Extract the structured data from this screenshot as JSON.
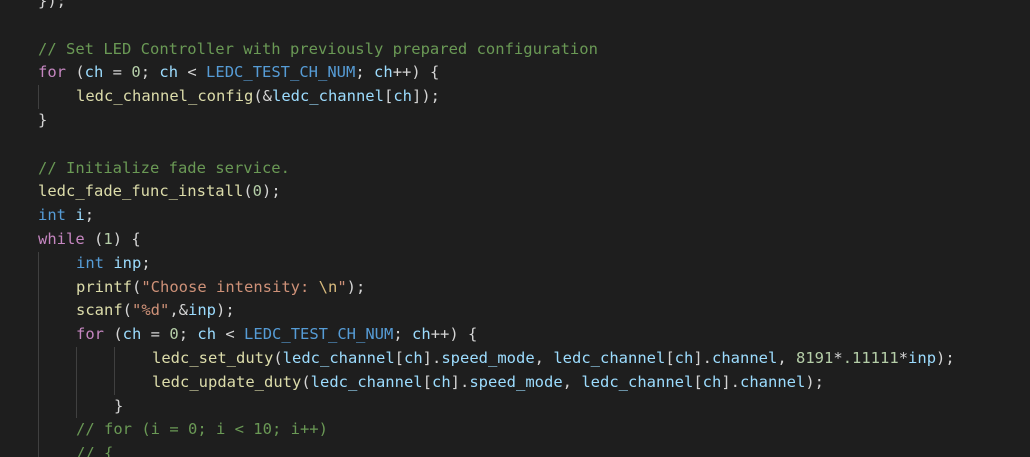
{
  "editor": {
    "background": "#1e1e1e",
    "theme_colors": {
      "keyword": "#569cd6",
      "control": "#c586c0",
      "function": "#dcdcaa",
      "variable": "#9cdcfe",
      "number": "#b5cea8",
      "string": "#ce9178",
      "comment": "#6a9955",
      "text": "#d4d4d4"
    },
    "lines": [
      {
        "indent": 0,
        "tokens": [
          [
            "pun",
            "});"
          ]
        ]
      },
      {
        "indent": 0,
        "tokens": []
      },
      {
        "indent": 0,
        "tokens": [
          [
            "cmt",
            "// Set LED Controller with previously prepared configuration"
          ]
        ]
      },
      {
        "indent": 0,
        "tokens": [
          [
            "ctl",
            "for"
          ],
          [
            "pun",
            " ("
          ],
          [
            "var",
            "ch"
          ],
          [
            "pun",
            " = "
          ],
          [
            "num",
            "0"
          ],
          [
            "pun",
            "; "
          ],
          [
            "var",
            "ch"
          ],
          [
            "pun",
            " < "
          ],
          [
            "mac",
            "LEDC_TEST_CH_NUM"
          ],
          [
            "pun",
            "; "
          ],
          [
            "var",
            "ch"
          ],
          [
            "pun",
            "++) {"
          ]
        ]
      },
      {
        "indent": 1,
        "tokens": [
          [
            "fn",
            "ledc_channel_config"
          ],
          [
            "pun",
            "(&"
          ],
          [
            "var",
            "ledc_channel"
          ],
          [
            "pun",
            "["
          ],
          [
            "var",
            "ch"
          ],
          [
            "pun",
            "]);"
          ]
        ]
      },
      {
        "indent": 0,
        "tokens": [
          [
            "pun",
            "}"
          ]
        ]
      },
      {
        "indent": 0,
        "tokens": []
      },
      {
        "indent": 0,
        "tokens": [
          [
            "cmt",
            "// Initialize fade service."
          ]
        ]
      },
      {
        "indent": 0,
        "tokens": [
          [
            "fn",
            "ledc_fade_func_install"
          ],
          [
            "pun",
            "("
          ],
          [
            "num",
            "0"
          ],
          [
            "pun",
            ");"
          ]
        ]
      },
      {
        "indent": 0,
        "tokens": [
          [
            "kw",
            "int"
          ],
          [
            "pun",
            " "
          ],
          [
            "var",
            "i"
          ],
          [
            "pun",
            ";"
          ]
        ]
      },
      {
        "indent": 0,
        "tokens": [
          [
            "ctl",
            "while"
          ],
          [
            "pun",
            " ("
          ],
          [
            "num",
            "1"
          ],
          [
            "pun",
            ") {"
          ]
        ]
      },
      {
        "indent": 1,
        "tokens": [
          [
            "kw",
            "int"
          ],
          [
            "pun",
            " "
          ],
          [
            "var",
            "inp"
          ],
          [
            "pun",
            ";"
          ]
        ]
      },
      {
        "indent": 1,
        "tokens": [
          [
            "fn",
            "printf"
          ],
          [
            "pun",
            "("
          ],
          [
            "str",
            "\"Choose intensity: "
          ],
          [
            "esc",
            "\\n"
          ],
          [
            "str",
            "\""
          ],
          [
            "pun",
            ");"
          ]
        ]
      },
      {
        "indent": 1,
        "tokens": [
          [
            "fn",
            "scanf"
          ],
          [
            "pun",
            "("
          ],
          [
            "str",
            "\"%d\""
          ],
          [
            "pun",
            ",&"
          ],
          [
            "var",
            "inp"
          ],
          [
            "pun",
            ");"
          ]
        ]
      },
      {
        "indent": 1,
        "tokens": [
          [
            "ctl",
            "for"
          ],
          [
            "pun",
            " ("
          ],
          [
            "var",
            "ch"
          ],
          [
            "pun",
            " = "
          ],
          [
            "num",
            "0"
          ],
          [
            "pun",
            "; "
          ],
          [
            "var",
            "ch"
          ],
          [
            "pun",
            " < "
          ],
          [
            "mac",
            "LEDC_TEST_CH_NUM"
          ],
          [
            "pun",
            "; "
          ],
          [
            "var",
            "ch"
          ],
          [
            "pun",
            "++) {"
          ]
        ]
      },
      {
        "indent": 3,
        "tokens": [
          [
            "fn",
            "ledc_set_duty"
          ],
          [
            "pun",
            "("
          ],
          [
            "var",
            "ledc_channel"
          ],
          [
            "pun",
            "["
          ],
          [
            "var",
            "ch"
          ],
          [
            "pun",
            "]."
          ],
          [
            "var",
            "speed_mode"
          ],
          [
            "pun",
            ", "
          ],
          [
            "var",
            "ledc_channel"
          ],
          [
            "pun",
            "["
          ],
          [
            "var",
            "ch"
          ],
          [
            "pun",
            "]."
          ],
          [
            "var",
            "channel"
          ],
          [
            "pun",
            ", "
          ],
          [
            "num",
            "8191"
          ],
          [
            "pun",
            "*"
          ],
          [
            "num",
            ".11111"
          ],
          [
            "pun",
            "*"
          ],
          [
            "var",
            "inp"
          ],
          [
            "pun",
            ");"
          ]
        ]
      },
      {
        "indent": 3,
        "tokens": [
          [
            "fn",
            "ledc_update_duty"
          ],
          [
            "pun",
            "("
          ],
          [
            "var",
            "ledc_channel"
          ],
          [
            "pun",
            "["
          ],
          [
            "var",
            "ch"
          ],
          [
            "pun",
            "]."
          ],
          [
            "var",
            "speed_mode"
          ],
          [
            "pun",
            ", "
          ],
          [
            "var",
            "ledc_channel"
          ],
          [
            "pun",
            "["
          ],
          [
            "var",
            "ch"
          ],
          [
            "pun",
            "]."
          ],
          [
            "var",
            "channel"
          ],
          [
            "pun",
            ");"
          ]
        ]
      },
      {
        "indent": 2,
        "tokens": [
          [
            "pun",
            "}"
          ]
        ]
      },
      {
        "indent": 1,
        "tokens": [
          [
            "cmt",
            "// for (i = 0; i < 10; i++)"
          ]
        ]
      },
      {
        "indent": 1,
        "tokens": [
          [
            "cmt",
            "// {"
          ]
        ]
      }
    ]
  }
}
